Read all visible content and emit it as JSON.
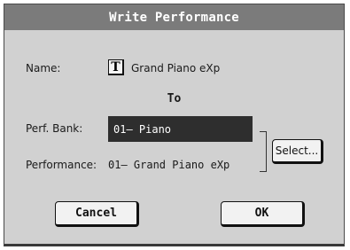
{
  "dialog": {
    "title": "Write Performance",
    "name_label": "Name:",
    "name_edit_icon_glyph": "T",
    "name_value": "Grand Piano eXp",
    "to_label": "To",
    "bank_label": "Perf. Bank:",
    "bank_value": "01– Piano",
    "performance_label": "Performance:",
    "performance_value": "01– Grand Piano eXp",
    "select_label": "Select...",
    "cancel_label": "Cancel",
    "ok_label": "OK"
  },
  "colors": {
    "titlebar": "#7b7b7b",
    "dialog_bg": "#d1d1d1",
    "field_bg": "#2e2e2e"
  }
}
